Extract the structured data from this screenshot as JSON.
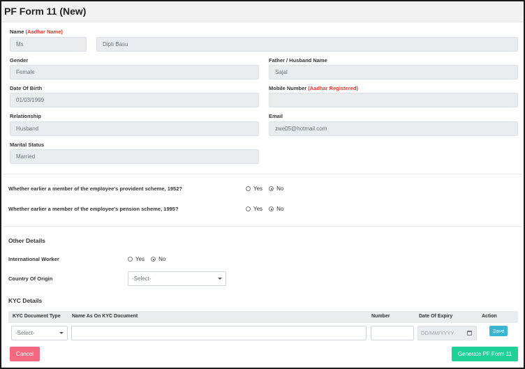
{
  "page": {
    "title": "PF Form 11 (New)"
  },
  "personal": {
    "name_label": "Name",
    "name_label_note": "(Aadhar Name)",
    "salutation_value": "Ms",
    "name_value": "Dipti Basu",
    "gender_label": "Gender",
    "gender_value": "Female",
    "father_label": "Father / Husband Name",
    "father_value": "Sajal",
    "dob_label": "Date Of Birth",
    "dob_value": "01/03/1999",
    "mobile_label": "Mobile Number",
    "mobile_label_note": "(Aadhar Registered)",
    "mobile_value": "",
    "relationship_label": "Relationship",
    "relationship_value": "Husband",
    "email_label": "Email",
    "email_value": "zwe05@hotmail.com",
    "marital_label": "Marital Status",
    "marital_value": "Married"
  },
  "questions": [
    {
      "text": "Whether earlier a member of the employee's provident scheme, 1952?",
      "yes": "Yes",
      "no": "No",
      "selected": "No"
    },
    {
      "text": "Whether earlier a member of the employee's pension scheme, 1995?",
      "yes": "Yes",
      "no": "No",
      "selected": "No"
    }
  ],
  "other": {
    "title": "Other Details",
    "intl_label": "International Worker",
    "intl_yes": "Yes",
    "intl_no": "No",
    "intl_selected": "No",
    "country_label": "Country Of Origin",
    "country_value": "-Select-"
  },
  "kyc": {
    "title": "KYC Details",
    "columns": [
      "KYC Document Type",
      "Name As On KYC Document",
      "Number",
      "Date Of Expiry",
      "Action"
    ],
    "row": {
      "type_value": "-Select-",
      "name_value": "",
      "number_value": "",
      "expiry_placeholder": "DD/MM/YYYY",
      "save_label": "Save"
    }
  },
  "actions": {
    "cancel_label": "Cancel",
    "generate_label": "Generate PF Form 11"
  },
  "colors": {
    "required": "#e3342f",
    "save": "#3cb4d4",
    "cancel": "#f3697f",
    "generate": "#1fd196"
  }
}
